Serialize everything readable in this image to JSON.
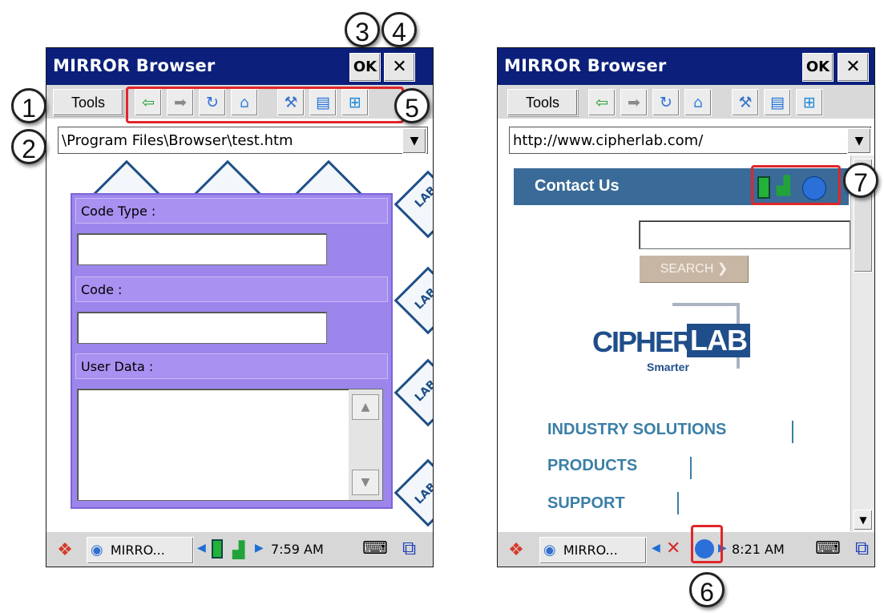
{
  "left_screen": {
    "window_title": "MIRROR Browser",
    "ok_label": "OK",
    "close_label": "✕",
    "tools_label": "Tools",
    "address_value": "\\Program Files\\Browser\\test.htm",
    "form": {
      "code_type_label": "Code Type :",
      "code_label": "Code :",
      "user_data_label": "User Data :"
    },
    "watermark_text": "LAB",
    "taskbar": {
      "app_label": "MIRRO...",
      "time": "7:59 AM"
    }
  },
  "right_screen": {
    "window_title": "MIRROR Browser",
    "ok_label": "OK",
    "close_label": "✕",
    "tools_label": "Tools",
    "address_value": "http://www.cipherlab.com/",
    "contact_label": "Contact Us",
    "search_button_label": "SEARCH",
    "logo_cipher": "CIPHER",
    "logo_lab": "LAB",
    "logo_tagline": "Smarter",
    "nav_links": [
      "INDUSTRY SOLUTIONS",
      "PRODUCTS",
      "SUPPORT"
    ],
    "taskbar": {
      "app_label": "MIRRO...",
      "time": "8:21 AM"
    }
  },
  "callouts": [
    "1",
    "2",
    "3",
    "4",
    "5",
    "6",
    "7"
  ],
  "icons": {
    "back": "back-arrow-icon",
    "forward": "forward-arrow-icon",
    "refresh": "refresh-icon",
    "home": "home-icon",
    "settings": "tools-settings-icon",
    "keyboard": "keyboard-icon",
    "fullscreen": "fullscreen-icon",
    "battery": "battery-icon",
    "signal": "signal-icon",
    "globe": "globe-icon",
    "start": "windows-start-icon"
  },
  "colors": {
    "title_bar": "#0b1f7b",
    "form_purple": "#9c86ec",
    "contact_bar": "#3a6b98",
    "link_blue": "#3b7fa6",
    "callout_red": "#e0262a"
  }
}
